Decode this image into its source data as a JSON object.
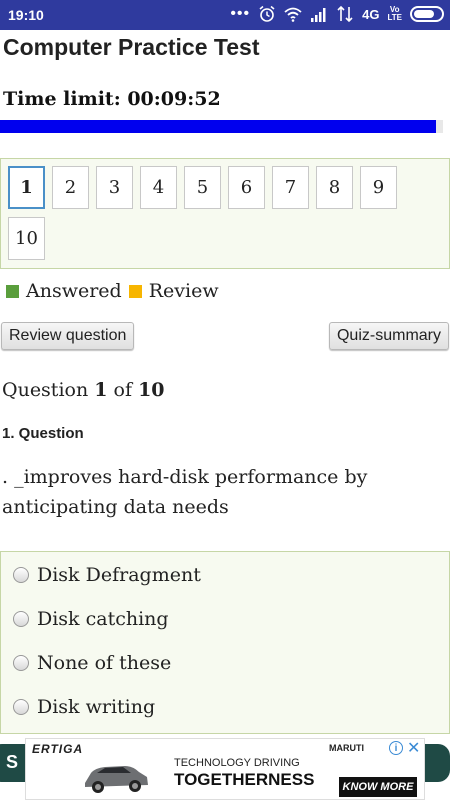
{
  "status_bar": {
    "time": "19:10",
    "dots": "•••",
    "network": "4G",
    "volte": "Vo\nLTE"
  },
  "app": {
    "title": "Computer Practice Test"
  },
  "timer": {
    "label": "Time limit: 00:09:52",
    "remaining_fraction": 0.985,
    "bar_color": "#0000ee"
  },
  "navigation": {
    "questions": [
      "1",
      "2",
      "3",
      "4",
      "5",
      "6",
      "7",
      "8",
      "9",
      "10"
    ],
    "current": "1"
  },
  "legend": {
    "answered": {
      "label": "Answered",
      "color": "#5a9e3c"
    },
    "review": {
      "label": "Review",
      "color": "#f7b500"
    }
  },
  "buttons": {
    "review_question": "Review question",
    "quiz_summary": "Quiz-summary"
  },
  "question": {
    "counter_prefix": "Question",
    "number": "1",
    "counter_mid": "of",
    "total": "10",
    "heading": "1. Question",
    "text": ". _improves hard-disk performance by anticipating data needs",
    "options": [
      "Disk Defragment",
      "Disk catching",
      "None of these",
      "Disk writing"
    ]
  },
  "submit": {
    "label": "S"
  },
  "ad": {
    "brand": "ERTIGA",
    "maker": "MARUTI",
    "tagline_1": "TECHNOLOGY DRIVING",
    "tagline_2": "TOGETHERNESS",
    "cta": "KNOW MORE",
    "info_icon": "info-icon",
    "close_icon": "close-icon"
  }
}
